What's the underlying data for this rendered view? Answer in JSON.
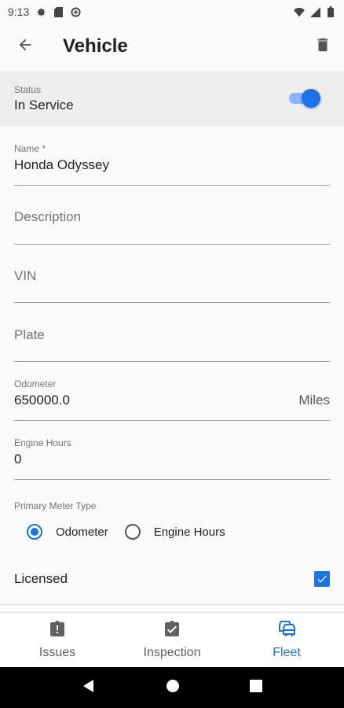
{
  "status_bar": {
    "time": "9:13"
  },
  "app_bar": {
    "title": "Vehicle"
  },
  "status_section": {
    "label": "Status",
    "value": "In Service",
    "toggle_on": true
  },
  "fields": {
    "name": {
      "label": "Name *",
      "value": "Honda Odyssey"
    },
    "description": {
      "placeholder": "Description"
    },
    "vin": {
      "placeholder": "VIN"
    },
    "plate": {
      "placeholder": "Plate"
    },
    "odometer": {
      "label": "Odometer",
      "value": "650000.0",
      "unit": "Miles"
    },
    "engine_hours": {
      "label": "Engine Hours",
      "value": "0"
    }
  },
  "primary_meter": {
    "label": "Primary Meter Type",
    "options": [
      "Odometer",
      "Engine Hours"
    ],
    "selected": "Odometer"
  },
  "licensed": {
    "label": "Licensed",
    "checked": true
  },
  "bottom_nav": {
    "items": [
      {
        "label": "Issues",
        "icon": "report-icon",
        "active": false
      },
      {
        "label": "Inspection",
        "icon": "checklist-icon",
        "active": false
      },
      {
        "label": "Fleet",
        "icon": "vehicles-icon",
        "active": true
      }
    ]
  },
  "colors": {
    "accent": "#1a73e8",
    "background": "#fafafa",
    "status_row_bg": "#eeeeee"
  }
}
